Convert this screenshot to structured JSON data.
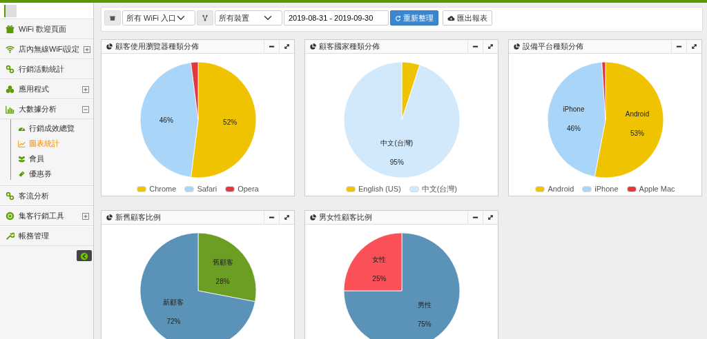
{
  "sidebar": {
    "items": [
      {
        "label": "WiFi 歡迎頁面",
        "kind": "gift"
      },
      {
        "label": "店內無線WiFi設定",
        "kind": "wifi",
        "expanded": false
      },
      {
        "label": "行銷活動統計",
        "kind": "link"
      },
      {
        "label": "應用程式",
        "kind": "cubes",
        "expanded": false
      },
      {
        "label": "大數據分析",
        "kind": "bars",
        "expanded": true,
        "children": [
          {
            "label": "行銷成效總覽",
            "kind": "gauge",
            "selected": false
          },
          {
            "label": "圖表統計",
            "kind": "line",
            "selected": true
          },
          {
            "label": "會員",
            "kind": "users",
            "selected": false
          },
          {
            "label": "優惠券",
            "kind": "ticket",
            "selected": false
          }
        ]
      },
      {
        "label": "客流分析",
        "kind": "link"
      },
      {
        "label": "集客行銷工具",
        "kind": "target",
        "expanded": false
      },
      {
        "label": "帳務管理",
        "kind": "wrench"
      }
    ]
  },
  "toolbar": {
    "entry_select": "所有 WiFi 入口",
    "device_select": "所有裝置",
    "date_range": "2019-08-31 - 2019-09-30",
    "refresh_button": "重新整理",
    "export_button": "匯出報表"
  },
  "cards": [
    {
      "title": "顧客使用瀏覽器種類分佈",
      "show_legend": true,
      "chart_data": {
        "type": "pie",
        "categories": [
          "Chrome",
          "Safari",
          "Opera"
        ],
        "values": [
          52,
          46,
          2
        ],
        "colors": [
          "#f0c300",
          "#a9d6f8",
          "#e0393e"
        ],
        "value_labels": [
          "52%",
          "46%",
          null
        ]
      }
    },
    {
      "title": "顧客國家種類分佈",
      "show_legend": true,
      "chart_data": {
        "type": "pie",
        "categories": [
          "English (US)",
          "中文(台灣)"
        ],
        "values": [
          5,
          95
        ],
        "colors": [
          "#f0c300",
          "#d2e8fb"
        ],
        "value_labels": [
          null,
          "95%"
        ],
        "data_labels": true
      }
    },
    {
      "title": "設備平台種類分佈",
      "show_legend": true,
      "chart_data": {
        "type": "pie",
        "categories": [
          "Android",
          "iPhone",
          "Apple Mac"
        ],
        "values": [
          53,
          46,
          1
        ],
        "colors": [
          "#f0c300",
          "#a9d6f8",
          "#e0393e"
        ],
        "value_labels": [
          "53%",
          "46%",
          null
        ],
        "data_labels": true
      }
    },
    {
      "title": "新舊顧客比例",
      "show_legend": false,
      "chart_data": {
        "type": "pie",
        "categories": [
          "舊顧客",
          "新顧客"
        ],
        "values": [
          28,
          72
        ],
        "colors": [
          "#6b9e22",
          "#5b93b8"
        ],
        "value_labels": [
          "28%",
          "72%"
        ],
        "data_labels": true
      }
    },
    {
      "title": "男女性顧客比例",
      "show_legend": false,
      "chart_data": {
        "type": "pie",
        "categories": [
          "男性",
          "女性"
        ],
        "values": [
          75,
          25
        ],
        "colors": [
          "#5b93b8",
          "#fa5058"
        ],
        "value_labels": [
          "75%",
          "25%"
        ],
        "data_labels": true
      }
    }
  ]
}
